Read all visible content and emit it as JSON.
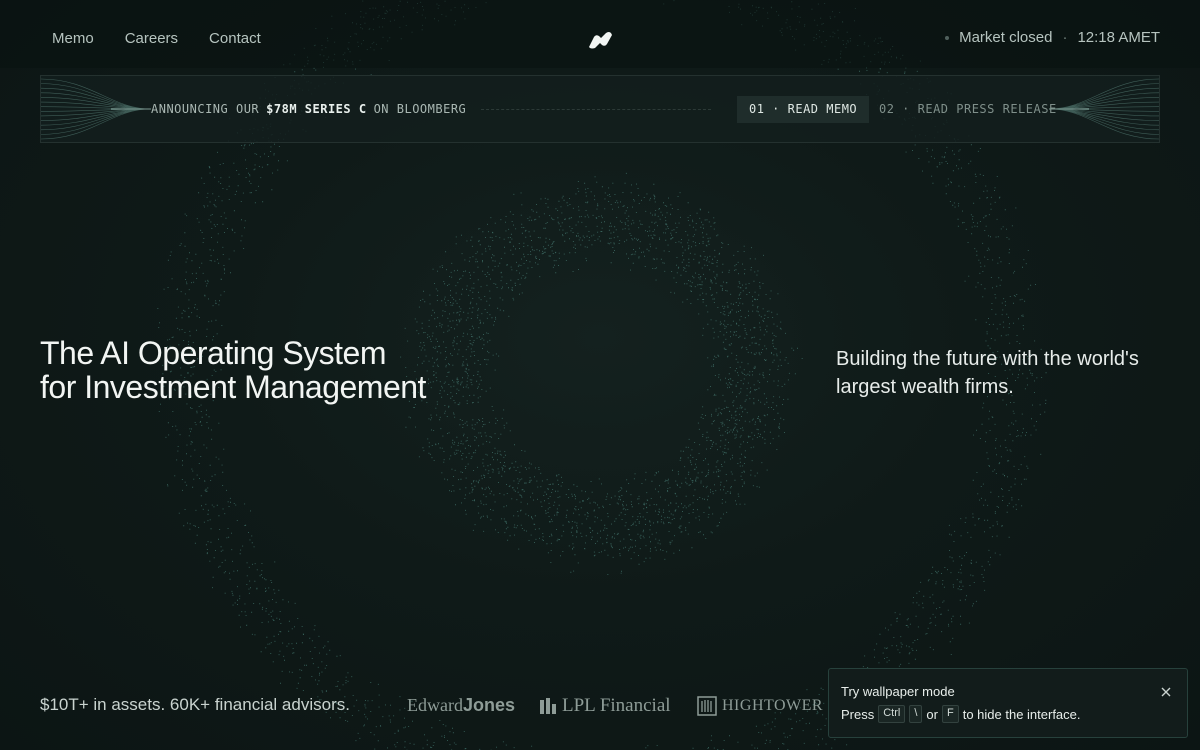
{
  "nav": {
    "links": [
      "Memo",
      "Careers",
      "Contact"
    ],
    "logo_icon": "brand-logo-icon",
    "market_status": "Market closed",
    "separator": "·",
    "time": "12:18 AMET"
  },
  "banner": {
    "announce_prefix": "ANNOUNCING OUR",
    "announce_highlight": "$78M SERIES C",
    "announce_suffix": "ON BLOOMBERG",
    "read_memo": "01 · READ MEMO",
    "press_release": "02 · READ PRESS RELEASE"
  },
  "hero": {
    "title_line1": "The AI Operating System",
    "title_line2": "for Investment Management",
    "subtitle": "Building the future with the world's largest wealth firms."
  },
  "footer": {
    "stats": "$10T+ in assets. 60K+ financial advisors.",
    "logos": {
      "edward_jones_1": "Edward",
      "edward_jones_2": "Jones",
      "lpl": "LPL Financial",
      "hightower": "HIGHTOWER"
    }
  },
  "toast": {
    "title": "Try wallpaper mode",
    "press": "Press",
    "key1": "Ctrl",
    "key2": "\\",
    "or": "or",
    "key3": "F",
    "suffix": "to hide the interface.",
    "close_icon": "close-icon"
  },
  "colors": {
    "background": "#0e1817",
    "particle": "#5fa79c",
    "text_primary": "#f2f5f3",
    "text_muted": "#b6c4bf"
  }
}
